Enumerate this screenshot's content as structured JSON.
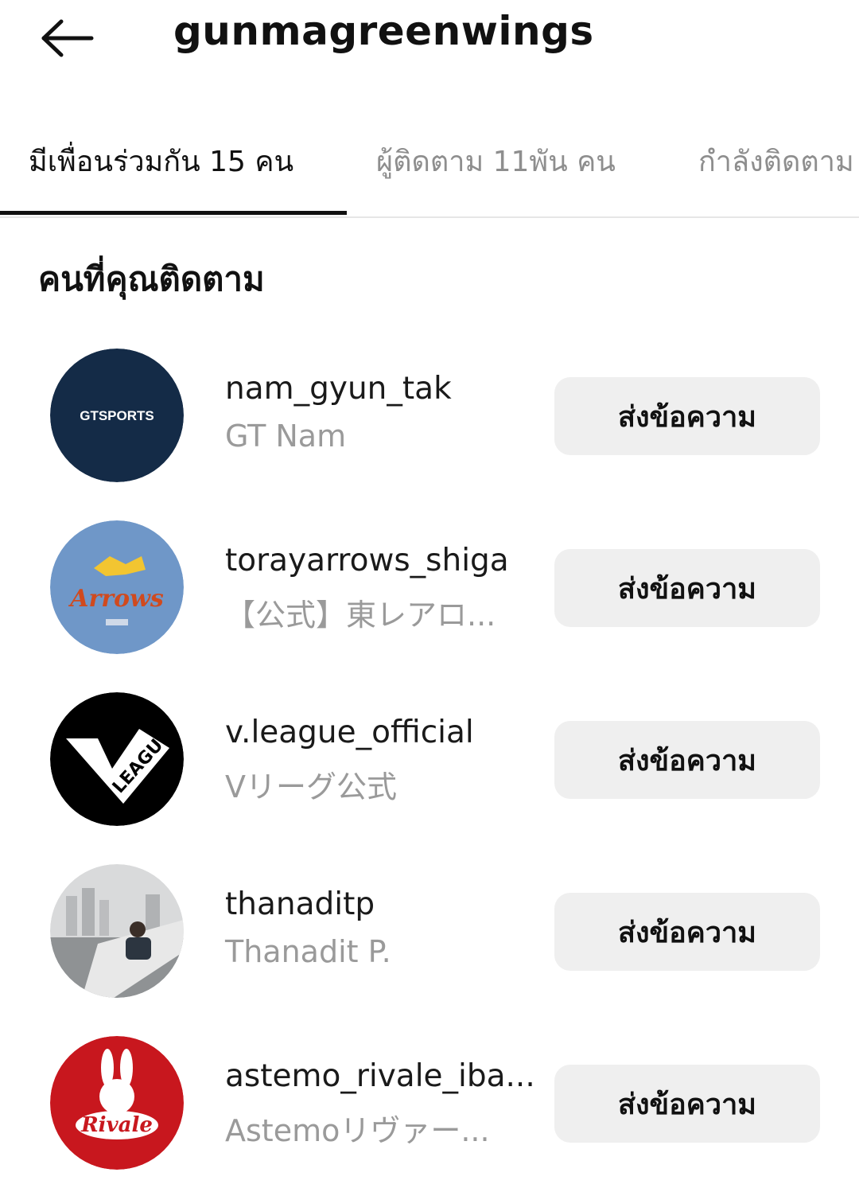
{
  "header": {
    "title": "gunmagreenwings",
    "back_icon": "arrow-left-icon"
  },
  "tabs": [
    {
      "label": "มีเพื่อนร่วมกัน 15 คน",
      "active": true
    },
    {
      "label": "ผู้ติดตาม 11พัน คน",
      "active": false
    },
    {
      "label": "กำลังติดตาม",
      "active": false
    }
  ],
  "section": {
    "title": "คนที่คุณติดตาม"
  },
  "users": [
    {
      "username": "nam_gyun_tak",
      "name": "GT Nam",
      "button": "ส่งข้อความ",
      "avatar_text": "GTSPORTS"
    },
    {
      "username": "torayarrows_shiga",
      "name": "【公式】東レアロ...",
      "button": "ส่งข้อความ",
      "avatar_text": "Arrows"
    },
    {
      "username": "v.league_official",
      "name": "Vリーグ公式",
      "button": "ส่งข้อความ",
      "avatar_text": "LEAGUE"
    },
    {
      "username": "thanaditp",
      "name": "Thanadit P.",
      "button": "ส่งข้อความ",
      "avatar_text": ""
    },
    {
      "username": "astemo_rivale_iba...",
      "name": "Astemoリヴァー...",
      "button": "ส่งข้อความ",
      "avatar_text": "Rivale"
    }
  ],
  "colors": {
    "button_bg": "#efefef",
    "secondary_text": "#9a9a9a",
    "tab_inactive": "#8e8e8e",
    "underline": "#111111"
  }
}
